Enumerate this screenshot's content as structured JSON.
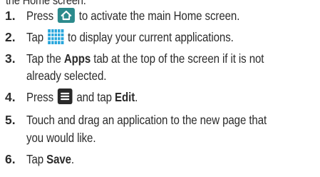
{
  "heading_partial": "the Home screen.",
  "steps": [
    {
      "number": "1.",
      "text_before": "Press",
      "icon": "home-key-icon",
      "text_after": "to activate the main Home screen."
    },
    {
      "number": "2.",
      "text_before": "Tap",
      "icon": "apps-grid-icon",
      "text_after": "to display your current applications."
    },
    {
      "number": "3.",
      "line1_before": "Tap the",
      "line1_bold": "Apps",
      "line1_after": "tab at the top of the screen if it is not",
      "line2": "already selected."
    },
    {
      "number": "4.",
      "text_before": "Press",
      "icon": "menu-key-icon",
      "text_middle": "and tap",
      "bold": "Edit",
      "text_end": "."
    },
    {
      "number": "5.",
      "line1": "Touch and drag an application to the new page that",
      "line2": "you would like."
    },
    {
      "number": "6.",
      "text_before": "Tap",
      "bold": "Save",
      "text_end": "."
    }
  ],
  "colors": {
    "home_icon": "#2c8a8c",
    "apps_grid": "#27a6dc",
    "menu_icon": "#2a2a2a",
    "text": "#2b2b2b"
  }
}
